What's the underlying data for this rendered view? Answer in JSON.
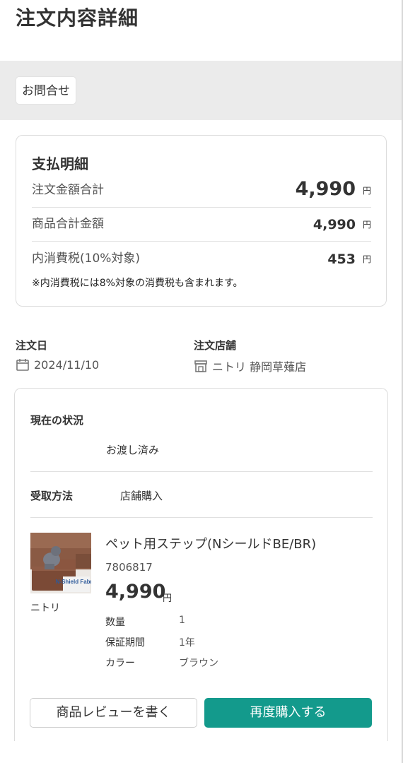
{
  "page": {
    "title": "注文内容詳細"
  },
  "contact": {
    "label": "お問合せ"
  },
  "payment": {
    "title": "支払明細",
    "rows": [
      {
        "label": "注文金額合計",
        "amount": "4,990",
        "unit": "円"
      },
      {
        "label": "商品合計金額",
        "amount": "4,990",
        "unit": "円"
      },
      {
        "label": "内消費税(10%対象)",
        "amount": "453",
        "unit": "円"
      }
    ],
    "note": "※内消費税には8%対象の消費税も含まれます。"
  },
  "order_meta": {
    "date_label": "注文日",
    "date_value": "2024/11/10",
    "date_icon": "calendar-icon",
    "store_label": "注文店舗",
    "store_value": "ニトリ 静岡草薙店",
    "store_icon": "store-icon"
  },
  "order": {
    "status_label": "現在の状況",
    "status_value": "お渡し済み",
    "receive_label": "受取方法",
    "receive_value": "店舗購入",
    "item": {
      "brand": "ニトリ",
      "name": "ペット用ステップ(NシールドBE/BR)",
      "code": "7806817",
      "price": "4,990",
      "unit": "円",
      "image_caption": "N-Shield Fabric",
      "specs": [
        {
          "key": "数量",
          "value": "1"
        },
        {
          "key": "保証期間",
          "value": "1年"
        },
        {
          "key": "カラー",
          "value": "ブラウン"
        }
      ]
    }
  },
  "actions": {
    "review_label": "商品レビューを書く",
    "rebuy_label": "再度購入する"
  },
  "colors": {
    "accent": "#139a8c",
    "band": "#ebebeb",
    "border": "#dcdcdc"
  }
}
